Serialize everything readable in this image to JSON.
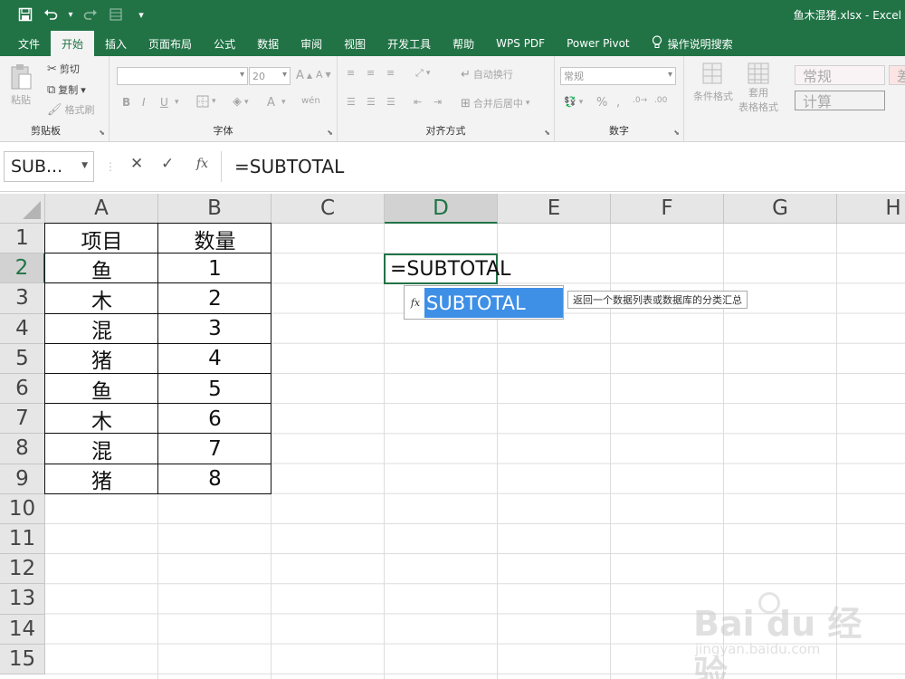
{
  "window": {
    "title": "鱼木混猪.xlsx  -  Excel"
  },
  "qat": {
    "undo_arrow": "▾",
    "customize": "▾"
  },
  "tabs": [
    {
      "label": "文件"
    },
    {
      "label": "开始"
    },
    {
      "label": "插入"
    },
    {
      "label": "页面布局"
    },
    {
      "label": "公式"
    },
    {
      "label": "数据"
    },
    {
      "label": "审阅"
    },
    {
      "label": "视图"
    },
    {
      "label": "开发工具"
    },
    {
      "label": "帮助"
    },
    {
      "label": "WPS PDF"
    },
    {
      "label": "Power Pivot"
    },
    {
      "label": "操作说明搜索"
    }
  ],
  "ribbon": {
    "clipboard": {
      "paste": "粘贴",
      "cut": "剪切",
      "copy": "复制",
      "format_painter": "格式刷",
      "label": "剪贴板"
    },
    "font": {
      "font_name": "",
      "font_size": "20",
      "bold": "B",
      "italic": "I",
      "underline": "U",
      "font_color": "A",
      "wen": "wén",
      "label": "字体"
    },
    "alignment": {
      "wrap": "自动换行",
      "merge": "合并后居中",
      "label": "对齐方式"
    },
    "number": {
      "format": "常规",
      "percent": "%",
      "comma": ",",
      "label": "数字"
    },
    "styles": {
      "conditional": "条件格式",
      "table_fmt_1": "套用",
      "table_fmt_2": "表格格式",
      "normal": "常规",
      "calc": "计算",
      "extra": "差"
    }
  },
  "formula_bar": {
    "name_box": "SUB...",
    "cancel": "✕",
    "enter": "✓",
    "fx": "fx",
    "formula": "=SUBTOTAL"
  },
  "columns": [
    "A",
    "B",
    "C",
    "D",
    "E",
    "F",
    "G",
    "H"
  ],
  "rows": [
    "1",
    "2",
    "3",
    "4",
    "5",
    "6",
    "7",
    "8",
    "9",
    "10",
    "11",
    "12",
    "13",
    "14",
    "15"
  ],
  "table": {
    "headers": [
      "项目",
      "数量"
    ],
    "rows": [
      [
        "鱼",
        "1"
      ],
      [
        "木",
        "2"
      ],
      [
        "混",
        "3"
      ],
      [
        "猪",
        "4"
      ],
      [
        "鱼",
        "5"
      ],
      [
        "木",
        "6"
      ],
      [
        "混",
        "7"
      ],
      [
        "猪",
        "8"
      ]
    ]
  },
  "active_cell": {
    "content": "=SUBTOTAL"
  },
  "autocomplete": {
    "icon": "fx",
    "item": "SUBTOTAL",
    "tooltip": "返回一个数据列表或数据库的分类汇总"
  },
  "watermark": {
    "main": "Bai du 经验",
    "sub": "jingyan.baidu.com"
  }
}
